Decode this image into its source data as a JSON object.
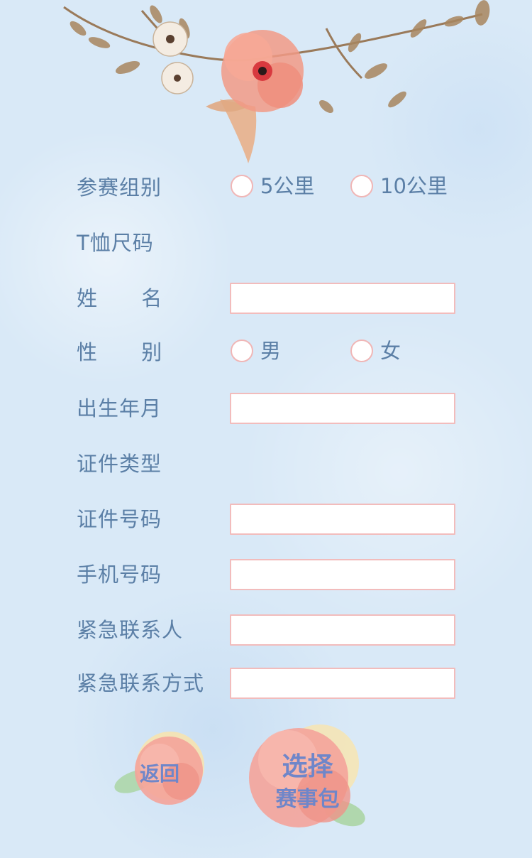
{
  "form": {
    "group_label": "参赛组别",
    "group_options": [
      "5公里",
      "10公里"
    ],
    "tshirt_label": "T恤尺码",
    "name_label": "姓      名",
    "gender_label": "性      别",
    "gender_options": [
      "男",
      "女"
    ],
    "birth_label": "出生年月",
    "id_type_label": "证件类型",
    "id_number_label": "证件号码",
    "phone_label": "手机号码",
    "emergency_contact_label": "紧急联系人",
    "emergency_method_label": "紧急联系方式"
  },
  "buttons": {
    "back_label": "返回",
    "choose_line1": "选择",
    "choose_line2": "赛事包"
  },
  "colors": {
    "label": "#5b7fa6",
    "field_border": "#f2bcbc",
    "button_text": "#6f86c9"
  }
}
